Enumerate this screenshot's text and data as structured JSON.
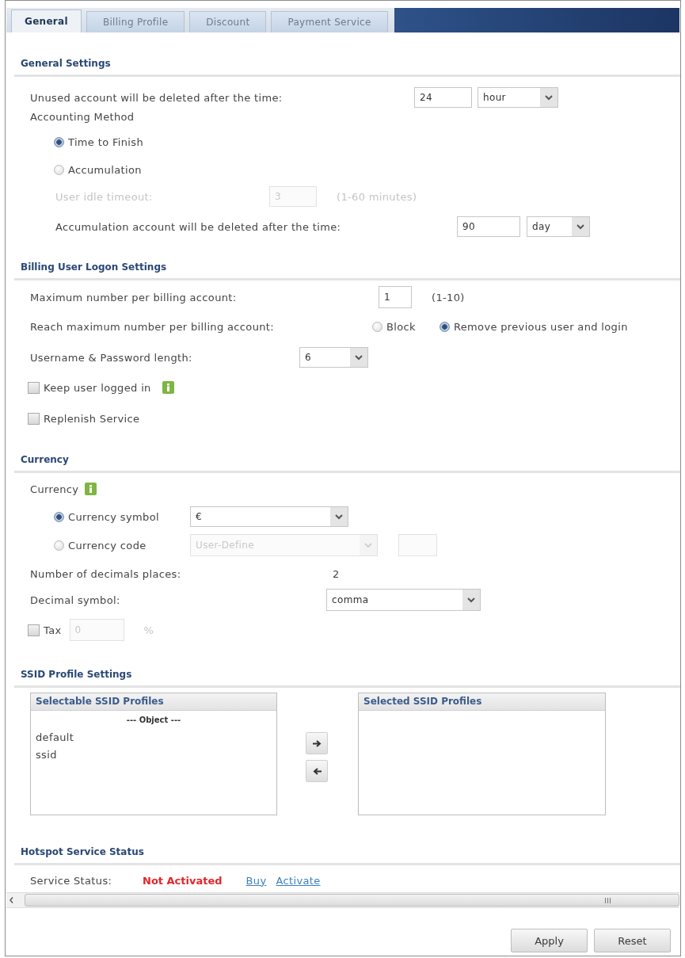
{
  "tabs": [
    {
      "label": "General",
      "selected": true
    },
    {
      "label": "Billing Profile",
      "selected": false
    },
    {
      "label": "Discount",
      "selected": false
    },
    {
      "label": "Payment Service",
      "selected": false
    }
  ],
  "general_settings": {
    "title": "General Settings",
    "unused_account": {
      "label": "Unused account will be deleted after the time:",
      "value": "24",
      "unit": "hour"
    },
    "accounting_method": {
      "label": "Accounting Method",
      "options": [
        {
          "label": "Time to Finish",
          "selected": true
        },
        {
          "label": "Accumulation",
          "selected": false
        }
      ]
    },
    "user_idle_timeout": {
      "label": "User idle timeout:",
      "value": "3",
      "hint": "(1-60 minutes)",
      "disabled": true
    },
    "accumulation_account": {
      "label": "Accumulation account will be deleted after the time:",
      "value": "90",
      "unit": "day"
    }
  },
  "billing_user_logon_settings": {
    "title": "Billing User Logon Settings",
    "maximum_number": {
      "label": "Maximum number per billing account:",
      "value": "1",
      "hint": "(1-10)"
    },
    "reach_maximum": {
      "label": "Reach maximum number per billing account:",
      "options": [
        {
          "label": "Block",
          "selected": false
        },
        {
          "label": "Remove previous user and login",
          "selected": true
        }
      ]
    },
    "password_length": {
      "label": "Username & Password length:",
      "value": "6"
    },
    "checkboxes": [
      {
        "label": "Keep user logged in",
        "checked": false,
        "info": true
      },
      {
        "label": "Replenish Service",
        "checked": false,
        "info": false
      }
    ]
  },
  "currency": {
    "title": "Currency",
    "label": "Currency",
    "info": true,
    "options": [
      {
        "kind": "symbol",
        "label": "Currency symbol",
        "selected": true,
        "value": "€"
      },
      {
        "kind": "code",
        "label": "Currency code",
        "selected": false,
        "value": "User-Define"
      }
    ],
    "decimals": {
      "label": "Number of decimals places:",
      "value": "2"
    },
    "decimal_symbol": {
      "label": "Decimal symbol:",
      "value": "comma"
    },
    "tax": {
      "label": "Tax",
      "checked": false,
      "value": "0",
      "unit": "%"
    }
  },
  "ssid_profile_settings": {
    "title": "SSID Profile Settings",
    "selectable": {
      "title": "Selectable SSID Profiles",
      "group": "--- Object ---",
      "items": [
        "default",
        "ssid"
      ]
    },
    "selected": {
      "title": "Selected SSID Profiles"
    }
  },
  "hotspot_service_status": {
    "title": "Hotspot Service Status",
    "label": "Service Status:",
    "status": "Not Activated",
    "links": [
      "Buy",
      "Activate"
    ]
  },
  "buttons": [
    "Apply",
    "Reset"
  ]
}
